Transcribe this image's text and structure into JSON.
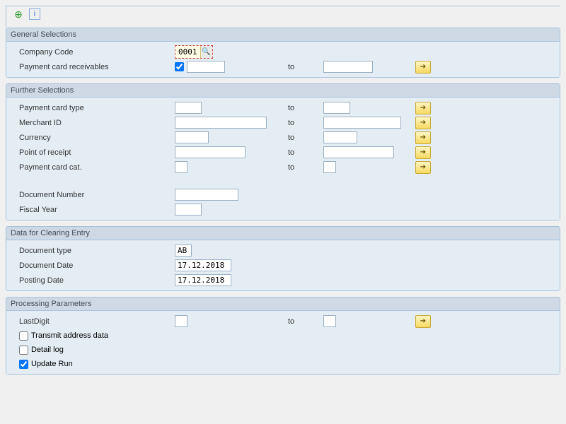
{
  "general": {
    "title": "General Selections",
    "company_code_label": "Company Code",
    "company_code_value": "0001",
    "receivables_label": "Payment card receivables",
    "receivables_checked": true,
    "to": "to"
  },
  "further": {
    "title": "Further Selections",
    "card_type_label": "Payment card type",
    "merchant_label": "Merchant ID",
    "currency_label": "Currency",
    "receipt_label": "Point of receipt",
    "cat_label": "Payment card cat.",
    "docnum_label": "Document Number",
    "fiscal_label": "Fiscal Year",
    "to": "to"
  },
  "clearing": {
    "title": "Data for Clearing Entry",
    "doctype_label": "Document type",
    "doctype_value": "AB",
    "docdate_label": "Document Date",
    "docdate_value": "17.12.2018",
    "postdate_label": "Posting Date",
    "postdate_value": "17.12.2018"
  },
  "processing": {
    "title": "Processing Parameters",
    "lastdigit_label": "LastDigit",
    "to": "to",
    "transmit_label": "Transmit address data",
    "detail_label": "Detail log",
    "update_label": "Update Run",
    "update_checked": true
  }
}
